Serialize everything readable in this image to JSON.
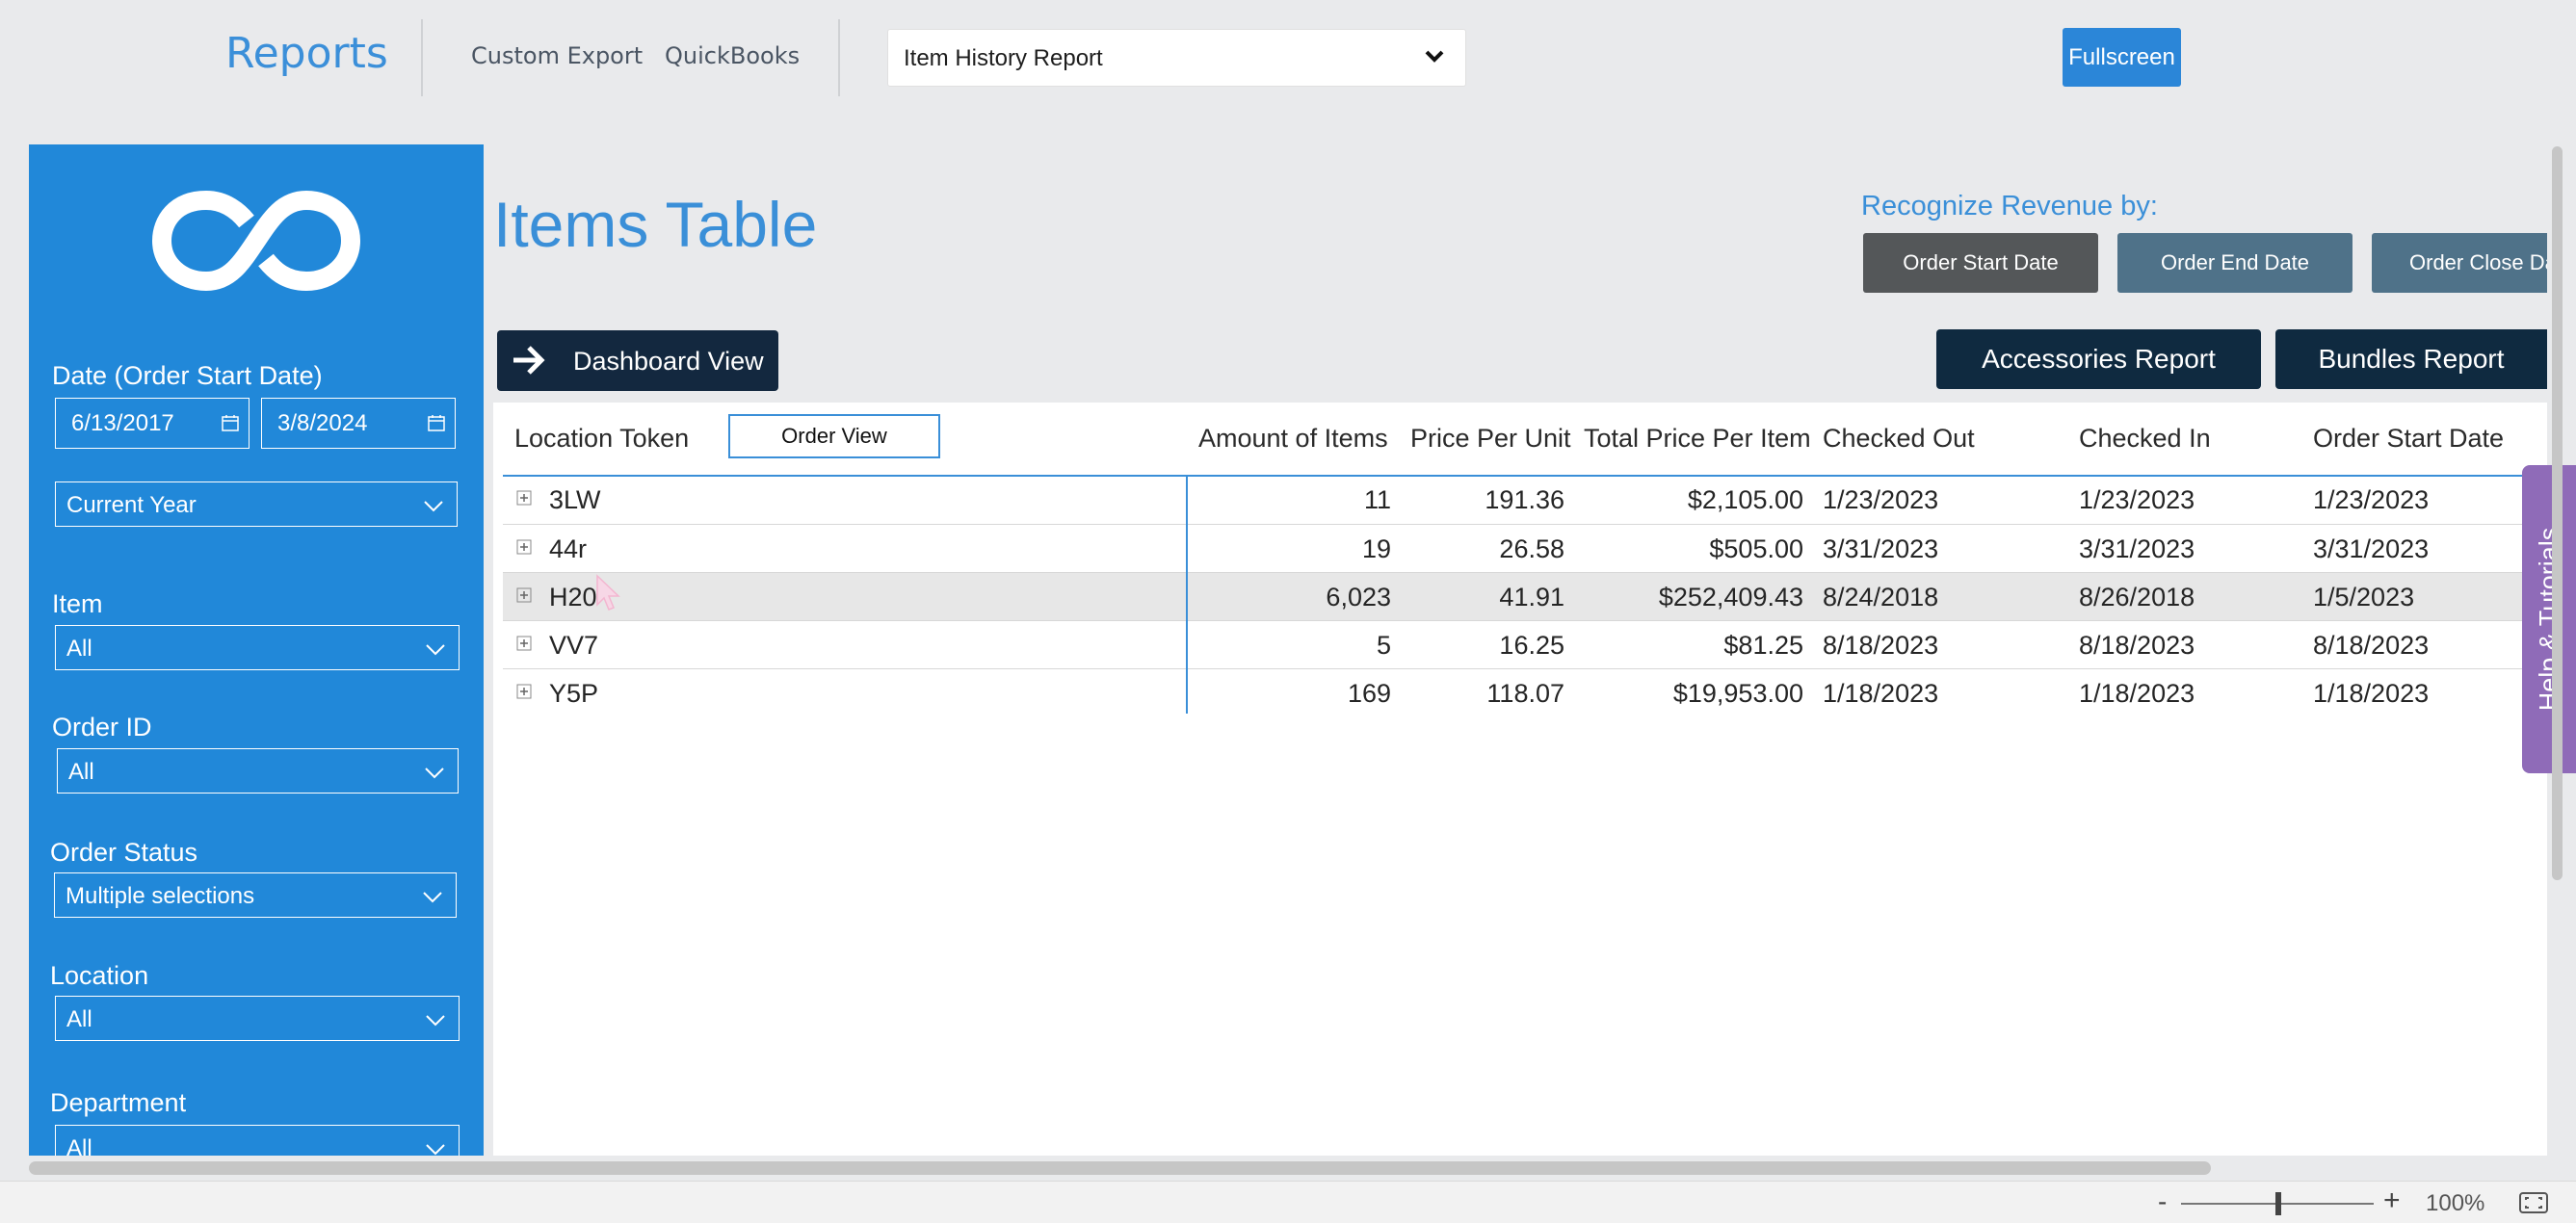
{
  "topnav": {
    "brand": "Reports",
    "links": [
      "Custom Export",
      "QuickBooks"
    ],
    "report_select": "Item History Report",
    "fullscreen": "Fullscreen"
  },
  "sidebar": {
    "date_label": "Date (Order Start Date)",
    "date_from": "6/13/2017",
    "date_to": "3/8/2024",
    "period": "Current Year",
    "item_label": "Item",
    "item_value": "All",
    "order_id_label": "Order ID",
    "order_id_value": "All",
    "order_status_label": "Order Status",
    "order_status_value": "Multiple selections",
    "location_label": "Location",
    "location_value": "All",
    "department_label": "Department",
    "department_value": "All"
  },
  "main": {
    "title": "Items Table",
    "recognize_label": "Recognize Revenue by:",
    "recognize_buttons": [
      "Order Start Date",
      "Order End Date",
      "Order Close Date"
    ],
    "dashboard_view": "Dashboard View",
    "accessories_report": "Accessories Report",
    "bundles_report": "Bundles Report",
    "order_view": "Order View"
  },
  "table": {
    "columns": [
      "Location Token",
      "Amount of Items",
      "Price Per Unit",
      "Total Price Per Item",
      "Checked Out",
      "Checked In",
      "Order Start Date"
    ],
    "rows": [
      {
        "token": "3LW",
        "amount": "11",
        "price": "191.36",
        "total": "$2,105.00",
        "out": "1/23/2023",
        "in": "1/23/2023",
        "start": "1/23/2023"
      },
      {
        "token": "44r",
        "amount": "19",
        "price": "26.58",
        "total": "$505.00",
        "out": "3/31/2023",
        "in": "3/31/2023",
        "start": "3/31/2023"
      },
      {
        "token": "H20",
        "amount": "6,023",
        "price": "41.91",
        "total": "$252,409.43",
        "out": "8/24/2018",
        "in": "8/26/2018",
        "start": "1/5/2023"
      },
      {
        "token": "VV7",
        "amount": "5",
        "price": "16.25",
        "total": "$81.25",
        "out": "8/18/2023",
        "in": "8/18/2023",
        "start": "8/18/2023"
      },
      {
        "token": "Y5P",
        "amount": "169",
        "price": "118.07",
        "total": "$19,953.00",
        "out": "1/18/2023",
        "in": "1/18/2023",
        "start": "1/18/2023"
      }
    ]
  },
  "help_tab": "Help & Tutorials",
  "zoom": {
    "minus": "-",
    "plus": "+",
    "percent": "100%"
  },
  "colors": {
    "accent": "#2188d9",
    "title_blue": "#3a8fd8",
    "dark_button": "#0f2a40",
    "recog_active": "#545759",
    "recog_inactive": "#4f7289",
    "help_purple": "#8f6bb8"
  }
}
